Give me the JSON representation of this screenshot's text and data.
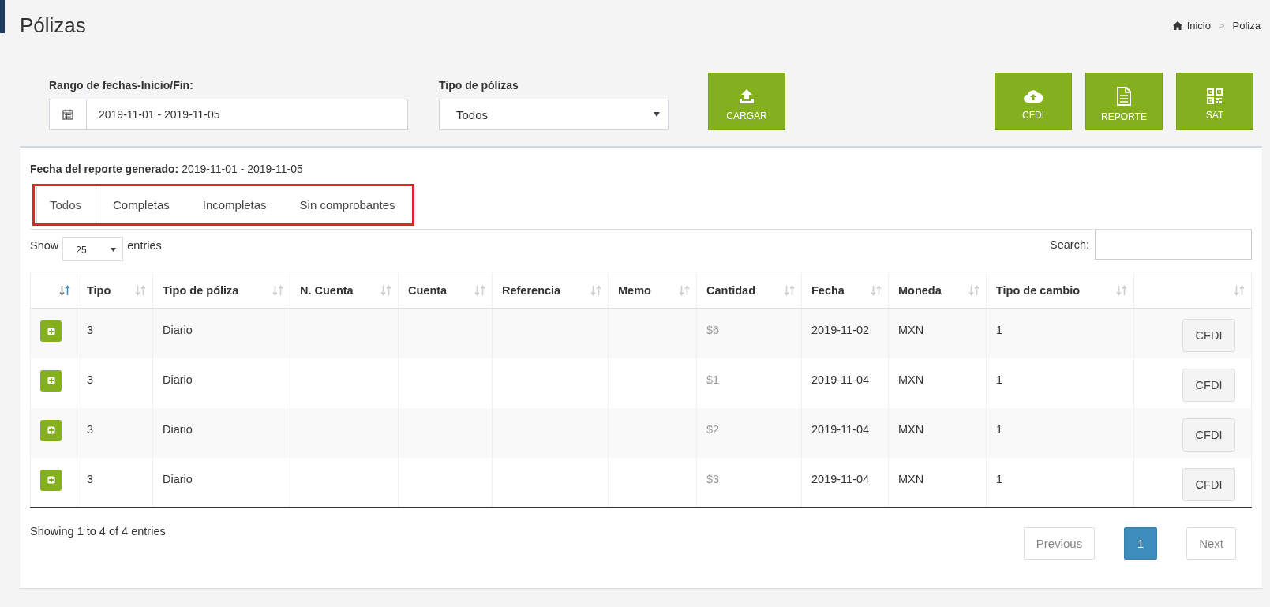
{
  "page_title": "Pólizas",
  "breadcrumb": [
    {
      "label": "Inicio",
      "kind": "home"
    },
    {
      "label": "Poliza",
      "kind": "current"
    }
  ],
  "breadcrumb_separator": ">",
  "filters": {
    "date_range": {
      "label": "Rango de fechas-Inicio/Fin:",
      "value": "2019-11-01 - 2019-11-05"
    },
    "policy_type": {
      "label": "Tipo de pólizas",
      "value": "Todos"
    }
  },
  "actions": [
    {
      "label": "CARGAR",
      "kind": "upload"
    },
    {
      "label": "CFDI",
      "kind": "cloud"
    },
    {
      "label": "REPORTE",
      "kind": "document"
    },
    {
      "label": "SAT",
      "kind": "qr"
    }
  ],
  "report_date": {
    "label": "Fecha del reporte generado:",
    "value": "2019-11-01 - 2019-11-05"
  },
  "tabs": [
    {
      "label": "Todos",
      "selected": true
    },
    {
      "label": "Completas",
      "selected": false
    },
    {
      "label": "Incompletas",
      "selected": false
    },
    {
      "label": "Sin comprobantes",
      "selected": false
    }
  ],
  "length_menu": {
    "before": "Show",
    "value": "25",
    "after": "entries"
  },
  "search": {
    "label": "Search:"
  },
  "table": {
    "columns": [
      {
        "sorted": true
      },
      {
        "label": "Tipo",
        "sorted": false
      },
      {
        "label": "Tipo de póliza",
        "sorted": false
      },
      {
        "label": "N. Cuenta",
        "sorted": false
      },
      {
        "label": "Cuenta",
        "sorted": false
      },
      {
        "label": "Referencia",
        "sorted": false
      },
      {
        "label": "Memo",
        "sorted": false
      },
      {
        "label": "Cantidad",
        "sorted": false
      },
      {
        "label": "Fecha",
        "sorted": false
      },
      {
        "label": "Moneda",
        "sorted": false
      },
      {
        "label": "Tipo de cambio",
        "sorted": false
      },
      {
        "sorted": false
      }
    ],
    "rows": [
      {
        "tipo": "3",
        "tipo_poliza": "Diario",
        "cantidad": "$6",
        "fecha": "2019-11-02",
        "moneda": "MXN",
        "tipo_cambio": "1",
        "action": "CFDI"
      },
      {
        "tipo": "3",
        "tipo_poliza": "Diario",
        "cantidad": "$1",
        "fecha": "2019-11-04",
        "moneda": "MXN",
        "tipo_cambio": "1",
        "action": "CFDI"
      },
      {
        "tipo": "3",
        "tipo_poliza": "Diario",
        "cantidad": "$2",
        "fecha": "2019-11-04",
        "moneda": "MXN",
        "tipo_cambio": "1",
        "action": "CFDI"
      },
      {
        "tipo": "3",
        "tipo_poliza": "Diario",
        "cantidad": "$3",
        "fecha": "2019-11-04",
        "moneda": "MXN",
        "tipo_cambio": "1",
        "action": "CFDI"
      }
    ]
  },
  "info": "Showing 1 to 4 of 4 entries",
  "pagination": [
    {
      "label": "Previous",
      "kind": "nav",
      "disabled": true,
      "selected": false
    },
    {
      "label": "1",
      "kind": "page",
      "disabled": false,
      "selected": true
    },
    {
      "label": "Next",
      "kind": "nav",
      "disabled": true,
      "selected": false
    }
  ]
}
